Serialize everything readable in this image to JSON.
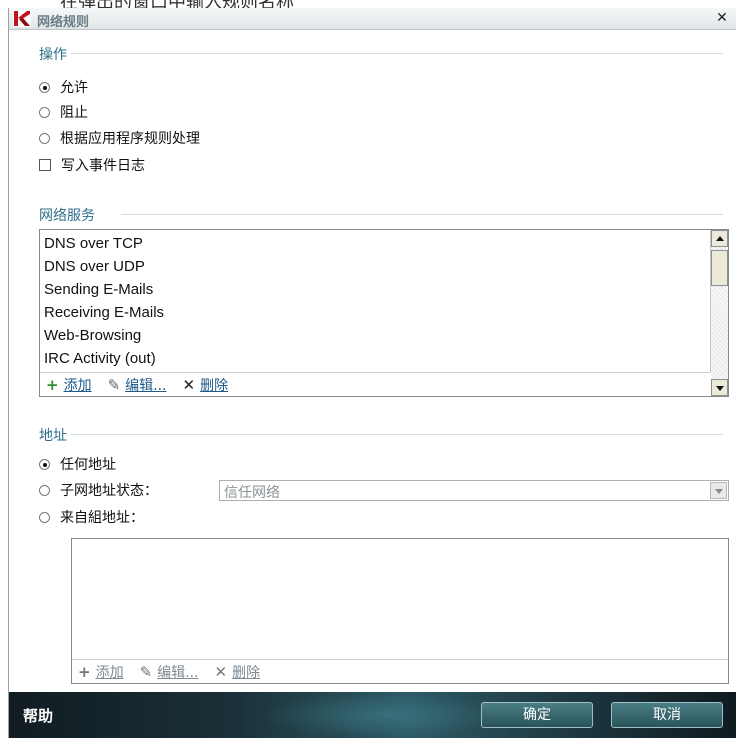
{
  "top_strip_text": "在弹出的窗口中输入规则名称",
  "window": {
    "title": "网络规则",
    "close_symbol": "✕"
  },
  "action_section": {
    "label": "操作",
    "options": [
      {
        "label": "允许",
        "selected": true
      },
      {
        "label": "阻止",
        "selected": false
      },
      {
        "label": "根据应用程序规则处理",
        "selected": false
      }
    ],
    "log_checkbox": {
      "label": "写入事件日志",
      "checked": false
    }
  },
  "services_section": {
    "label": "网络服务",
    "items": [
      "DNS over TCP",
      "DNS over UDP",
      "Sending E-Mails",
      "Receiving E-Mails",
      "Web-Browsing",
      "IRC Activity (out)"
    ],
    "toolbar": {
      "add": "添加",
      "edit": "编辑...",
      "delete": "删除"
    }
  },
  "address_section": {
    "label": "地址",
    "options": [
      {
        "label": "任何地址",
        "selected": true
      },
      {
        "label": "子网地址状态：",
        "selected": false
      },
      {
        "label": "来自組地址：",
        "selected": false
      }
    ],
    "subnet_select_value": "信任网络",
    "toolbar": {
      "add": "添加",
      "edit": "编辑...",
      "delete": "删除"
    }
  },
  "footer": {
    "help": "帮助",
    "ok": "确定",
    "cancel": "取消"
  },
  "colors": {
    "section_label": "#2e6f8a",
    "link": "#1e5a8a",
    "footer_dark": "#111c22",
    "footer_teal": "#2d5a66"
  },
  "icons": {
    "app": "kaspersky-k-icon",
    "add": "plus-icon",
    "edit": "pencil-icon",
    "delete": "x-icon"
  }
}
